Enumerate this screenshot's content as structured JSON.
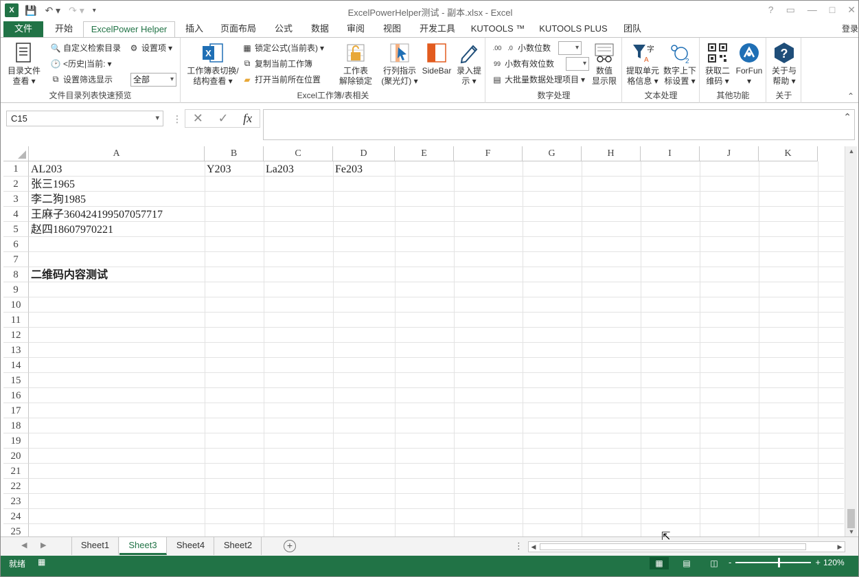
{
  "title": "ExcelPowerHelper测试 - 副本.xlsx - Excel",
  "window_buttons": [
    "?",
    "▭",
    "—",
    "□",
    "✕"
  ],
  "tabs": [
    "文件",
    "开始",
    "ExcelPower Helper",
    "插入",
    "页面布局",
    "公式",
    "数据",
    "审阅",
    "视图",
    "开发工具",
    "KUTOOLS ™",
    "KUTOOLS PLUS",
    "团队"
  ],
  "login": "登录",
  "ribbon": {
    "group1": {
      "label": "文件目录列表快速预览",
      "big_btn_l1": "目录文件",
      "big_btn_l2": "查看",
      "custom_dir": "自定义检索目录",
      "settings": "设置项",
      "history": "<历史|当前:",
      "filter": "设置筛选显示",
      "combo_value": "全部"
    },
    "group2": {
      "label": "Excel工作簿/表相关",
      "switch_l1": "工作簿表切换/",
      "switch_l2": "结构查看",
      "lock_formula": "锁定公式(当前表)",
      "copy_book": "复制当前工作簿",
      "open_location": "打开当前所在位置",
      "unlock_l1": "工作表",
      "unlock_l2": "解除锁定",
      "rowcol_l1": "行列指示",
      "rowcol_l2": "(聚光灯)",
      "sidebar": "SideBar",
      "input_l1": "录入提",
      "input_l2": "示"
    },
    "group3": {
      "label": "数字处理",
      "decimals": "小数位数",
      "sigdigits": "小数有效位数",
      "batch": "大批量数据处理项目",
      "limit_l1": "数值",
      "limit_l2": "显示限"
    },
    "group4": {
      "label": "文本处理",
      "extract_l1": "提取单元",
      "extract_l2": "格信息",
      "superscript_l1": "数字上下",
      "superscript_l2": "标设置"
    },
    "group5": {
      "label": "其他功能",
      "qr_l1": "获取二",
      "qr_l2": "维码",
      "forfun": "ForFun"
    },
    "group6": {
      "label": "关于",
      "about_l1": "关于与",
      "about_l2": "帮助"
    }
  },
  "formula_bar": {
    "name_box": "C15",
    "cancel": "✕",
    "enter": "✓",
    "fx": "fx",
    "value": ""
  },
  "columns": [
    "A",
    "B",
    "C",
    "D",
    "E",
    "F",
    "G",
    "H",
    "I",
    "J",
    "K"
  ],
  "rows": [
    "1",
    "2",
    "3",
    "4",
    "5",
    "6",
    "7",
    "8",
    "9",
    "10",
    "11",
    "12",
    "13",
    "14",
    "15",
    "16",
    "17",
    "18",
    "19",
    "20",
    "21",
    "22",
    "23",
    "24",
    "25"
  ],
  "cells": {
    "A1": "AL203",
    "B1": "Y203",
    "C1": "La203",
    "D1": "Fe203",
    "A2": "张三1965",
    "A3": "李二狗1985",
    "A4": "王麻子360424199507057717",
    "A5": "赵四18607970221",
    "A8": "二维码内容测试"
  },
  "sheets": [
    "Sheet1",
    "Sheet3",
    "Sheet4",
    "Sheet2"
  ],
  "active_sheet": "Sheet3",
  "status": {
    "ready": "就绪",
    "zoom": "120%",
    "zoom_minus": "-",
    "zoom_plus": "+"
  }
}
